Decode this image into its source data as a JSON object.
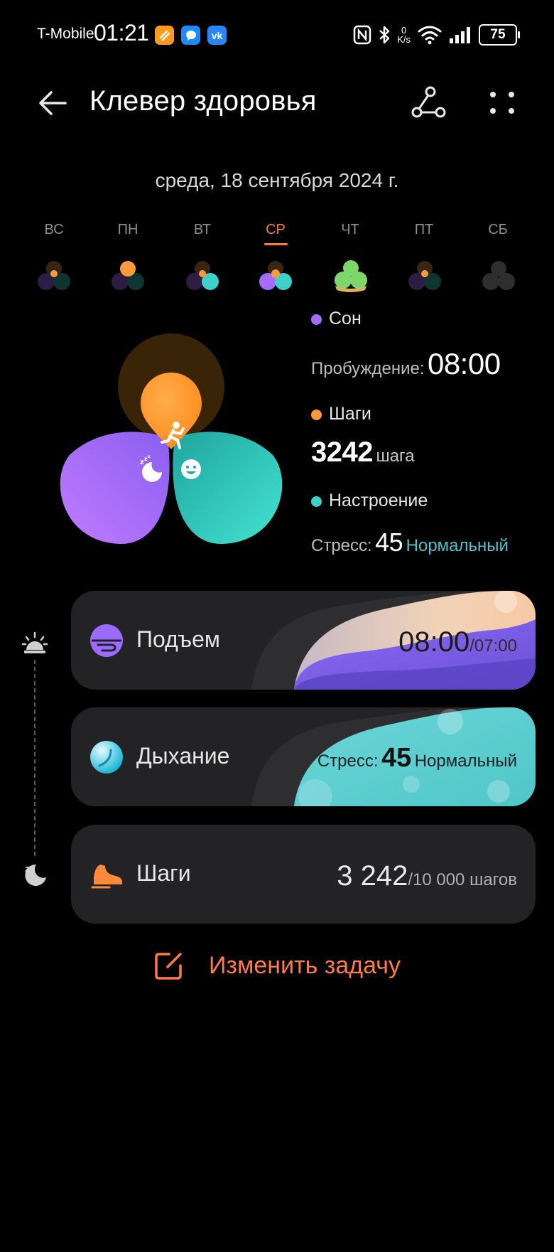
{
  "status_bar": {
    "carrier": "T-Mobile",
    "time": "01:21",
    "net_speed_value": "0",
    "net_speed_unit": "K/s",
    "battery": "75"
  },
  "header": {
    "title": "Клевер здоровья"
  },
  "date": "среда, 18 сентября 2024 г.",
  "week": {
    "days": [
      "ВС",
      "ПН",
      "ВТ",
      "СР",
      "ЧТ",
      "ПТ",
      "СБ"
    ],
    "active_day": "СР"
  },
  "legend": {
    "sleep": {
      "label": "Сон",
      "detail_label": "Пробуждение:",
      "value": "08:00"
    },
    "steps": {
      "label": "Шаги",
      "value": "3242",
      "unit": "шага"
    },
    "mood": {
      "label": "Настроение",
      "detail_label": "Стресс:",
      "value": "45",
      "status": "Нормальный"
    }
  },
  "cards": {
    "wakeup": {
      "title": "Подъем",
      "value": "08:00",
      "target": "/07:00"
    },
    "breathing": {
      "title": "Дыхание",
      "label": "Стресс:",
      "value": "45",
      "status": "Нормальный"
    },
    "steps": {
      "title": "Шаги",
      "value": "3 242",
      "target": "/10 000 шагов"
    }
  },
  "edit_task": "Изменить задачу",
  "colors": {
    "sleep": "#a66cff",
    "steps": "#ff9a3c",
    "mood": "#3dd1c9",
    "accent": "#ff7a2f",
    "edit": "#ff7a45"
  }
}
